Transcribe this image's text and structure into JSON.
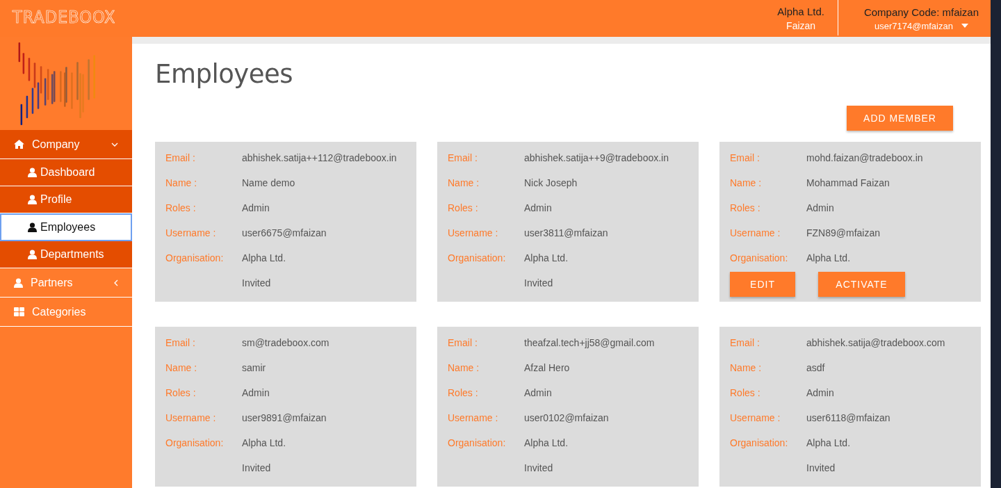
{
  "header": {
    "brand": "TRADEBOOX",
    "company": "Alpha Ltd.",
    "user_name": "Faizan",
    "company_code": "Company Code: mfaizan",
    "user_id": "user7174@mfaizan"
  },
  "sidebar": {
    "items": [
      {
        "label": "Company",
        "kind": "home",
        "expanded": true,
        "children": [
          {
            "label": "Dashboard",
            "selected": false
          },
          {
            "label": "Profile",
            "selected": false
          },
          {
            "label": "Employees",
            "selected": true
          },
          {
            "label": "Departments",
            "selected": false
          }
        ]
      },
      {
        "label": "Partners",
        "kind": "person",
        "expanded": false
      },
      {
        "label": "Categories",
        "kind": "grid"
      }
    ]
  },
  "page": {
    "title": "Employees",
    "add_button": "ADD MEMBER"
  },
  "employees": [
    {
      "fields": [
        {
          "label": "Email :",
          "value": "abhishek.satija++112@tradeboox.in"
        },
        {
          "label": "Name :",
          "value": "Name demo"
        },
        {
          "label": "Roles :",
          "value": "Admin"
        },
        {
          "label": "Username :",
          "value": "user6675@mfaizan"
        },
        {
          "label": "Organisation:",
          "value": "Alpha Ltd."
        }
      ],
      "status": "Invited"
    },
    {
      "fields": [
        {
          "label": "Email :",
          "value": "abhishek.satija++9@tradeboox.in"
        },
        {
          "label": "Name :",
          "value": "Nick Joseph"
        },
        {
          "label": "Roles :",
          "value": "Admin"
        },
        {
          "label": "Username :",
          "value": "user3811@mfaizan"
        },
        {
          "label": "Organisation:",
          "value": "Alpha Ltd."
        }
      ],
      "status": "Invited"
    },
    {
      "fields": [
        {
          "label": "Email :",
          "value": "mohd.faizan@tradeboox.in"
        },
        {
          "label": "Name :",
          "value": "Mohammad Faizan"
        },
        {
          "label": "Roles :",
          "value": "Admin"
        },
        {
          "label": "Username :",
          "value": "FZN89@mfaizan"
        },
        {
          "label": "Organisation:",
          "value": "Alpha Ltd."
        }
      ],
      "buttons": [
        "EDIT",
        "ACTIVATE"
      ]
    },
    {
      "fields": [
        {
          "label": "Email :",
          "value": "sm@tradeboox.com"
        },
        {
          "label": "Name :",
          "value": "samir"
        },
        {
          "label": "Roles :",
          "value": "Admin"
        },
        {
          "label": "Username :",
          "value": "user9891@mfaizan"
        },
        {
          "label": "Organisation:",
          "value": "Alpha Ltd."
        }
      ],
      "status": "Invited"
    },
    {
      "fields": [
        {
          "label": "Email :",
          "value": "theafzal.tech+jj58@gmail.com"
        },
        {
          "label": "Name :",
          "value": "Afzal Hero"
        },
        {
          "label": "Roles :",
          "value": "Admin"
        },
        {
          "label": "Username :",
          "value": "user0102@mfaizan"
        },
        {
          "label": "Organisation:",
          "value": "Alpha Ltd."
        }
      ],
      "status": "Invited"
    },
    {
      "fields": [
        {
          "label": "Email :",
          "value": "abhishek.satija@tradeboox.com"
        },
        {
          "label": "Name :",
          "value": "asdf"
        },
        {
          "label": "Roles :",
          "value": "Admin"
        },
        {
          "label": "Username :",
          "value": "user6118@mfaizan"
        },
        {
          "label": "Organisation:",
          "value": "Alpha Ltd."
        }
      ],
      "status": "Invited"
    }
  ]
}
